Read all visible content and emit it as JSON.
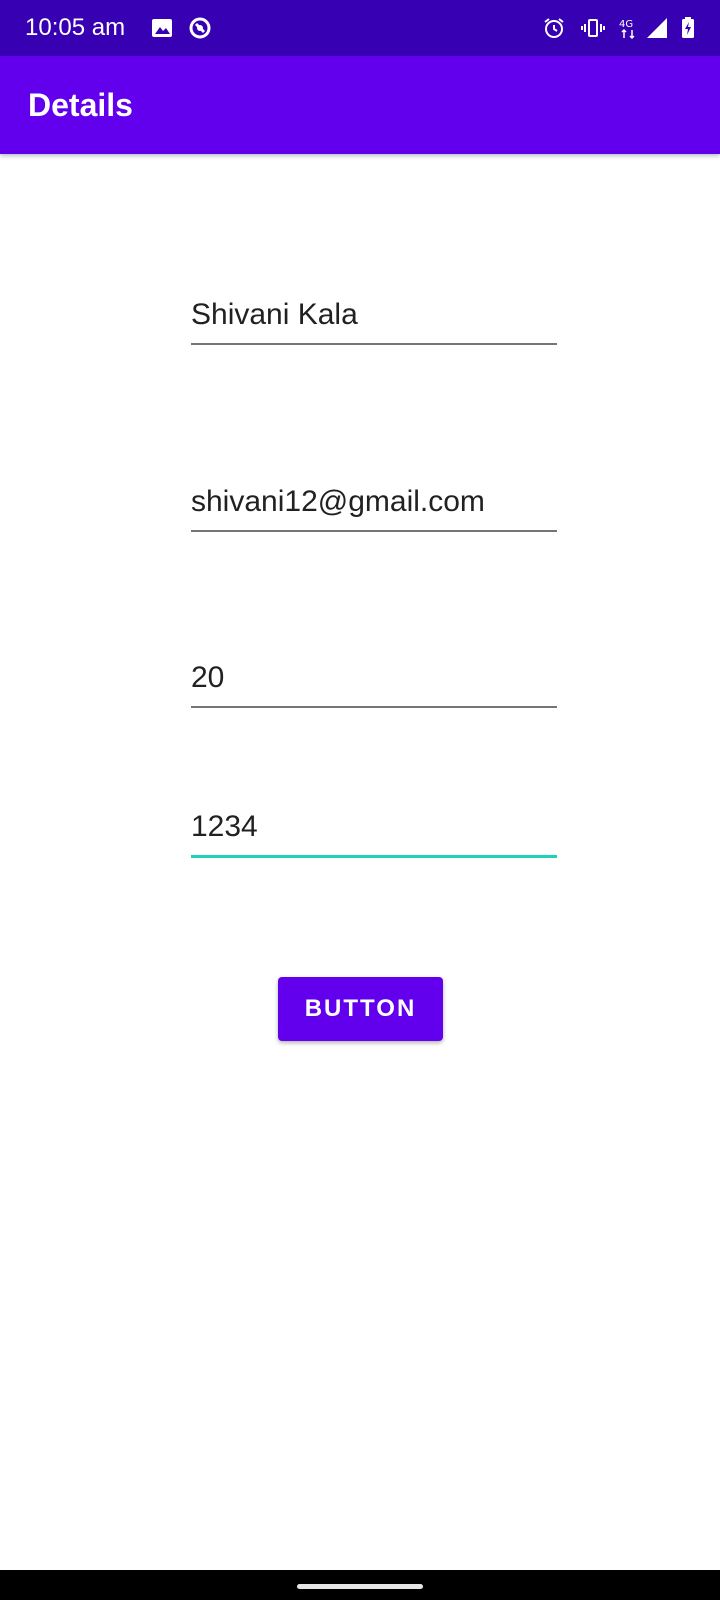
{
  "status_bar": {
    "time": "10:05 am",
    "icons_left": [
      "image-icon",
      "sync-icon"
    ],
    "icons_right": [
      "alarm-icon",
      "vibrate-icon",
      "network-4g-icon",
      "signal-icon",
      "battery-charging-icon"
    ],
    "network_label": "4G",
    "background": "#3700b3"
  },
  "app_bar": {
    "title": "Details",
    "background": "#6200ee"
  },
  "form": {
    "name_value": "Shivani Kala",
    "email_value": "shivani12@gmail.com",
    "age_value": "20",
    "password_value": "1234",
    "focus_color": "#1fd1b9"
  },
  "button": {
    "label": "BUTTON",
    "background": "#6200ee"
  }
}
